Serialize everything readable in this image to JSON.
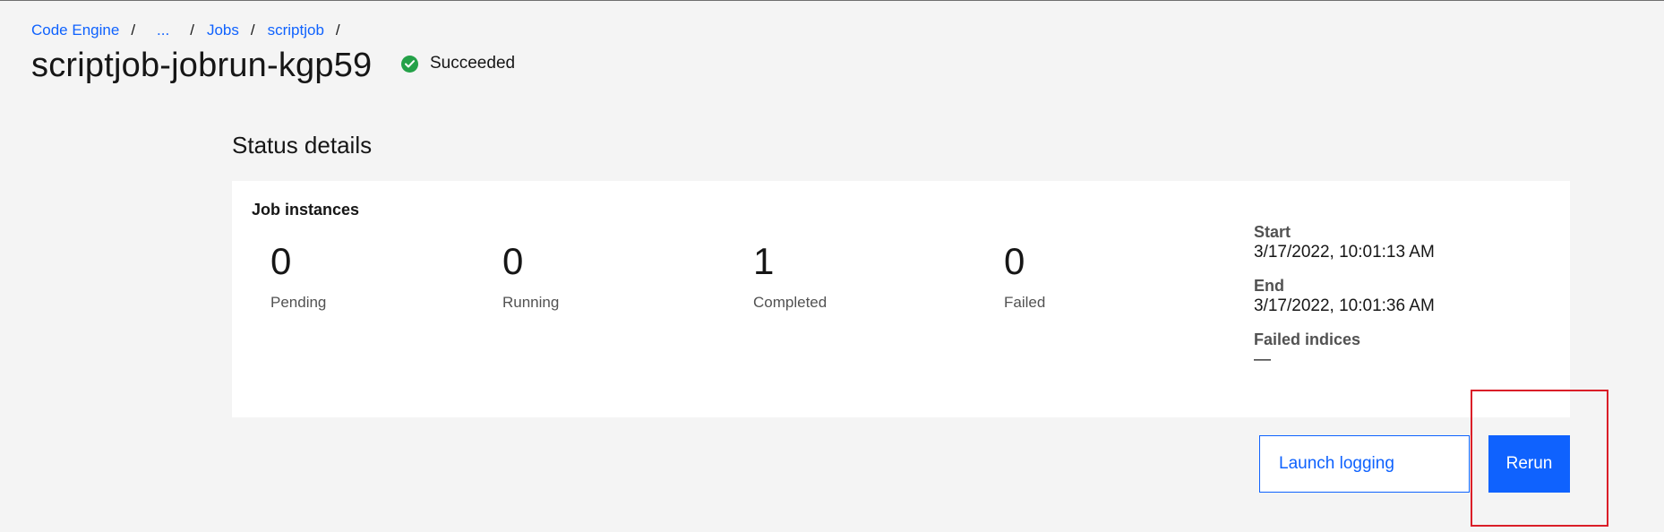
{
  "breadcrumb": {
    "items": [
      {
        "label": "Code Engine"
      },
      {
        "label": "..."
      },
      {
        "label": "Jobs"
      },
      {
        "label": "scriptjob"
      }
    ],
    "separator": "/"
  },
  "page": {
    "title": "scriptjob-jobrun-kgp59",
    "status": "Succeeded",
    "status_icon": "checkmark-filled-icon",
    "status_color": "#24a148"
  },
  "status_details": {
    "heading": "Status details",
    "card_title": "Job instances",
    "metrics": [
      {
        "value": "0",
        "label": "Pending"
      },
      {
        "value": "0",
        "label": "Running"
      },
      {
        "value": "1",
        "label": "Completed"
      },
      {
        "value": "0",
        "label": "Failed"
      }
    ],
    "details": {
      "start_label": "Start",
      "start_value": "3/17/2022, 10:01:13 AM",
      "end_label": "End",
      "end_value": "3/17/2022, 10:01:36 AM",
      "failed_indices_label": "Failed indices",
      "failed_indices_value": "—"
    }
  },
  "actions": {
    "launch_logging_label": "Launch logging",
    "rerun_label": "Rerun"
  },
  "colors": {
    "accent": "#0f62fe",
    "highlight": "#da1e28",
    "background": "#f4f4f4"
  }
}
